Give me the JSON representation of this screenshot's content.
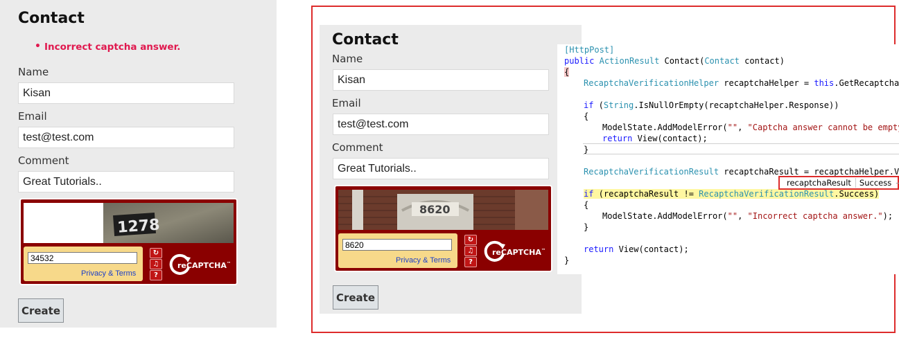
{
  "left_form": {
    "heading": "Contact",
    "errors": [
      "Incorrect captcha answer."
    ],
    "name_label": "Name",
    "name_value": "Kisan",
    "email_label": "Email",
    "email_value": "test@test.com",
    "comment_label": "Comment",
    "comment_value": "Great Tutorials..",
    "captcha_answer": "34532",
    "captcha_image_text": "1278",
    "privacy_label": "Privacy & Terms",
    "create_label": "Create"
  },
  "right_form": {
    "heading": "Contact",
    "name_label": "Name",
    "name_value": "Kisan",
    "email_label": "Email",
    "email_value": "test@test.com",
    "comment_label": "Comment",
    "comment_value": "Great Tutorials..",
    "captcha_answer": "8620",
    "captcha_image_text": "8620",
    "privacy_label": "Privacy & Terms",
    "create_label": "Create"
  },
  "recaptcha": {
    "logo_text": "reCAPTCHA",
    "tm": "™",
    "icons": [
      "refresh-icon",
      "audio-icon",
      "help-icon"
    ]
  },
  "code": {
    "lines": [
      "[HttpPost]",
      "public ActionResult Contact(Contact contact)",
      "{",
      "RecaptchaVerificationHelper recaptchaHelper = this.GetRecaptchaVe",
      "",
      "if (String.IsNullOrEmpty(recaptchaHelper.Response))",
      "{",
      "ModelState.AddModelError(\"\", \"Captcha answer cannot be empty.",
      "return View(contact);",
      "}",
      "",
      "RecaptchaVerificationResult recaptchaResult = recaptchaHelper.Ver",
      "",
      "if (recaptchaResult != RecaptchaVerificationResult.Success)",
      "{",
      "ModelState.AddModelError(\"\", \"Incorrect captcha answer.\");",
      "}",
      "",
      "return View(contact);",
      "}"
    ],
    "datatip_name": "recaptchaResult",
    "datatip_value": "Success"
  },
  "colors": {
    "error": "#e0184e",
    "captcha_red": "#8a0000",
    "frame_red": "#dd2b2b",
    "panel_grey": "#ebebeb"
  }
}
